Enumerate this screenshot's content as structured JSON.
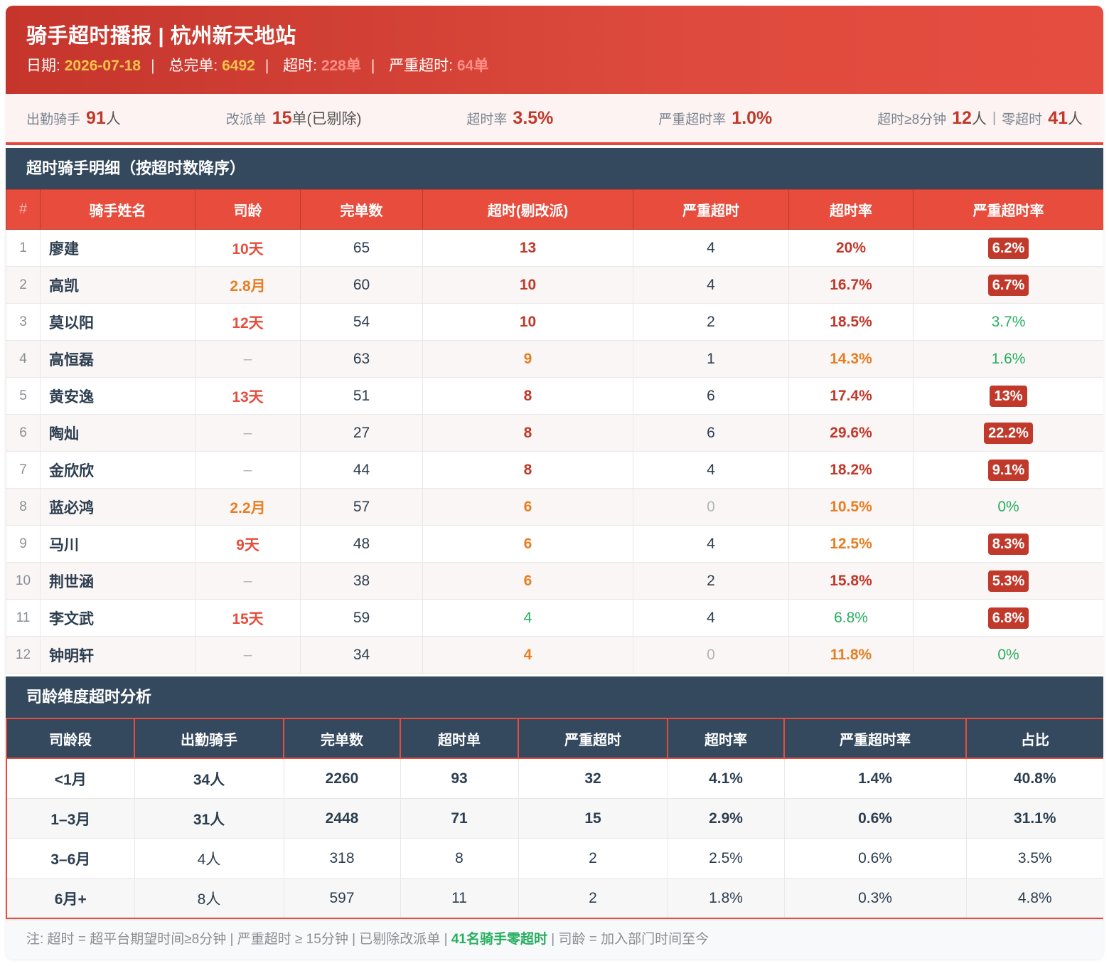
{
  "header": {
    "title": "骑手超时播报 | 杭州新天地站",
    "date_label": "日期:",
    "date_value": "2026-07-18",
    "total_label": "总完单:",
    "total_value": "6492",
    "timeout_label": "超时:",
    "timeout_value": "228单",
    "severe_label": "严重超时:",
    "severe_value": "64单"
  },
  "summary": {
    "riders_label": "出勤骑手",
    "riders_value": "91",
    "riders_unit": "人",
    "reassign_label": "改派单",
    "reassign_value": "15",
    "reassign_unit": "单(已剔除)",
    "rate_label": "超时率",
    "rate_value": "3.5%",
    "severe_rate_label": "严重超时率",
    "severe_rate_value": "1.0%",
    "over8_label": "超时≥8分钟",
    "over8_value": "12",
    "over8_unit": "人",
    "zero_label": "零超时",
    "zero_value": "41",
    "zero_unit": "人"
  },
  "detail": {
    "title": "超时骑手明细（按超时数降序）",
    "columns": [
      "#",
      "骑手姓名",
      "司龄",
      "完单数",
      "超时(剔改派)",
      "严重超时",
      "超时率",
      "严重超时率"
    ],
    "rows": [
      {
        "idx": "1",
        "name": "廖建",
        "tenure": "10天",
        "tenure_cls": "red",
        "done": "65",
        "timeout": "13",
        "timeout_cls": "dred",
        "severe": "4",
        "severe_cls": "",
        "rate": "20%",
        "rate_cls": "dred",
        "srate": "6.2%",
        "srate_cls": "badge"
      },
      {
        "idx": "2",
        "name": "高凯",
        "tenure": "2.8月",
        "tenure_cls": "orange",
        "done": "60",
        "timeout": "10",
        "timeout_cls": "dred",
        "severe": "4",
        "severe_cls": "",
        "rate": "16.7%",
        "rate_cls": "dred",
        "srate": "6.7%",
        "srate_cls": "badge"
      },
      {
        "idx": "3",
        "name": "莫以阳",
        "tenure": "12天",
        "tenure_cls": "red",
        "done": "54",
        "timeout": "10",
        "timeout_cls": "dred",
        "severe": "2",
        "severe_cls": "",
        "rate": "18.5%",
        "rate_cls": "dred",
        "srate": "3.7%",
        "srate_cls": "green"
      },
      {
        "idx": "4",
        "name": "高恒磊",
        "tenure": "–",
        "tenure_cls": "muted",
        "done": "63",
        "timeout": "9",
        "timeout_cls": "orange",
        "severe": "1",
        "severe_cls": "",
        "rate": "14.3%",
        "rate_cls": "orange",
        "srate": "1.6%",
        "srate_cls": "green"
      },
      {
        "idx": "5",
        "name": "黄安逸",
        "tenure": "13天",
        "tenure_cls": "red",
        "done": "51",
        "timeout": "8",
        "timeout_cls": "dred",
        "severe": "6",
        "severe_cls": "",
        "rate": "17.4%",
        "rate_cls": "dred",
        "srate": "13%",
        "srate_cls": "badge"
      },
      {
        "idx": "6",
        "name": "陶灿",
        "tenure": "–",
        "tenure_cls": "muted",
        "done": "27",
        "timeout": "8",
        "timeout_cls": "dred",
        "severe": "6",
        "severe_cls": "",
        "rate": "29.6%",
        "rate_cls": "dred",
        "srate": "22.2%",
        "srate_cls": "badge"
      },
      {
        "idx": "7",
        "name": "金欣欣",
        "tenure": "–",
        "tenure_cls": "muted",
        "done": "44",
        "timeout": "8",
        "timeout_cls": "dred",
        "severe": "4",
        "severe_cls": "",
        "rate": "18.2%",
        "rate_cls": "dred",
        "srate": "9.1%",
        "srate_cls": "badge"
      },
      {
        "idx": "8",
        "name": "蓝必鸿",
        "tenure": "2.2月",
        "tenure_cls": "orange",
        "done": "57",
        "timeout": "6",
        "timeout_cls": "orange",
        "severe": "0",
        "severe_cls": "muted",
        "rate": "10.5%",
        "rate_cls": "orange",
        "srate": "0%",
        "srate_cls": "green"
      },
      {
        "idx": "9",
        "name": "马川",
        "tenure": "9天",
        "tenure_cls": "red",
        "done": "48",
        "timeout": "6",
        "timeout_cls": "orange",
        "severe": "4",
        "severe_cls": "",
        "rate": "12.5%",
        "rate_cls": "orange",
        "srate": "8.3%",
        "srate_cls": "badge"
      },
      {
        "idx": "10",
        "name": "荆世涵",
        "tenure": "–",
        "tenure_cls": "muted",
        "done": "38",
        "timeout": "6",
        "timeout_cls": "orange",
        "severe": "2",
        "severe_cls": "",
        "rate": "15.8%",
        "rate_cls": "dred",
        "srate": "5.3%",
        "srate_cls": "badge"
      },
      {
        "idx": "11",
        "name": "李文武",
        "tenure": "15天",
        "tenure_cls": "red",
        "done": "59",
        "timeout": "4",
        "timeout_cls": "green",
        "severe": "4",
        "severe_cls": "",
        "rate": "6.8%",
        "rate_cls": "green",
        "srate": "6.8%",
        "srate_cls": "badge"
      },
      {
        "idx": "12",
        "name": "钟明轩",
        "tenure": "–",
        "tenure_cls": "muted",
        "done": "34",
        "timeout": "4",
        "timeout_cls": "orange",
        "severe": "0",
        "severe_cls": "muted",
        "rate": "11.8%",
        "rate_cls": "orange",
        "srate": "0%",
        "srate_cls": "green"
      }
    ]
  },
  "tenure_analysis": {
    "title": "司龄维度超时分析",
    "columns": [
      "司龄段",
      "出勤骑手",
      "完单数",
      "超时单",
      "严重超时",
      "超时率",
      "严重超时率",
      "占比"
    ],
    "rows": [
      {
        "band": "<1月",
        "riders": "34人",
        "done": "2260",
        "timeout": "93",
        "severe": "32",
        "rate": "4.1%",
        "srate": "1.4%",
        "share": "40.8%",
        "bold": true,
        "share_cls": "dred"
      },
      {
        "band": "1–3月",
        "riders": "31人",
        "done": "2448",
        "timeout": "71",
        "severe": "15",
        "rate": "2.9%",
        "srate": "0.6%",
        "share": "31.1%",
        "bold": true,
        "share_cls": "dred"
      },
      {
        "band": "3–6月",
        "riders": "4人",
        "done": "318",
        "timeout": "8",
        "severe": "2",
        "rate": "2.5%",
        "srate": "0.6%",
        "share": "3.5%",
        "bold": false,
        "share_cls": ""
      },
      {
        "band": "6月+",
        "riders": "8人",
        "done": "597",
        "timeout": "11",
        "severe": "2",
        "rate": "1.8%",
        "srate": "0.3%",
        "share": "4.8%",
        "bold": false,
        "share_cls": ""
      }
    ]
  },
  "note": {
    "prefix": "注: 超时 = 超平台期望时间≥8分钟 | 严重超时 ≥ 15分钟 | 已剔除改派单 | ",
    "highlight": "41名骑手零超时",
    "suffix": " | 司龄 = 加入部门时间至今"
  },
  "colors": {
    "header_red": "#dd4a3d",
    "table_head_red": "#e74c3c",
    "section_navy": "#34495e",
    "badge_red": "#c0392b",
    "good_green": "#27ae60",
    "warn_orange": "#e67e22",
    "date_yellow": "#f7c34a"
  }
}
